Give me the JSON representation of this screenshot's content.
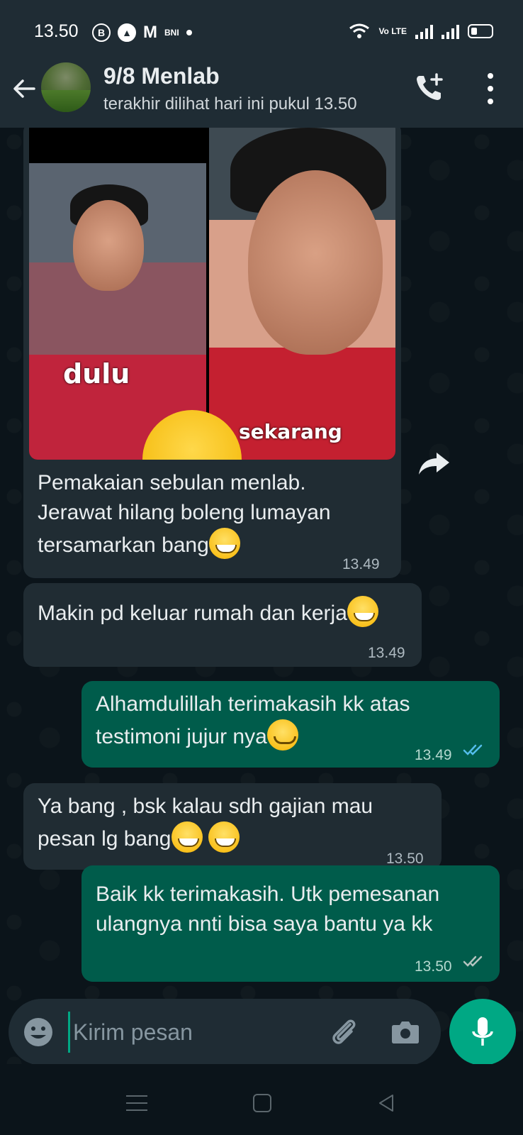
{
  "status_bar": {
    "time": "13.50",
    "notif_b": "B",
    "notif_m": "M",
    "notif_bni": "BNI",
    "volte": "Vo LTE"
  },
  "header": {
    "contact_name": "9/8 Menlab",
    "last_seen": "terakhir dilihat hari ini pukul 13.50"
  },
  "messages": [
    {
      "direction": "in",
      "has_photo": true,
      "photo_labels": [
        "dulu",
        "sekarang"
      ],
      "text_lines": [
        "Pemakaian sebulan menlab.",
        "Jerawat hilang boleng lumayan",
        "tersamarkan bang"
      ],
      "time": "13.49"
    },
    {
      "direction": "in",
      "text_lines": [
        "Makin pd keluar rumah dan kerja"
      ],
      "time": "13.49"
    },
    {
      "direction": "out",
      "text_lines": [
        "Alhamdulillah terimakasih kk atas",
        "testimoni jujur nya"
      ],
      "time": "13.49",
      "ticks": "read"
    },
    {
      "direction": "in",
      "text_lines": [
        "Ya bang , bsk kalau sdh gajian mau",
        "pesan lg bang"
      ],
      "time": "13.50"
    },
    {
      "direction": "out",
      "text_lines": [
        "Baik kk terimakasih. Utk  pemesanan",
        "ulangnya nnti bisa saya bantu ya kk"
      ],
      "time": "13.50",
      "ticks": "delivered"
    }
  ],
  "composer": {
    "placeholder": "Kirim pesan"
  },
  "colors": {
    "header_bg": "#1f2c34",
    "chat_bg": "#0b141a",
    "incoming_bubble": "#202c33",
    "outgoing_bubble": "#005c4b",
    "accent": "#00a884",
    "read_tick": "#53bdeb"
  },
  "icons": [
    "back-arrow-icon",
    "add-call-icon",
    "more-vert-icon",
    "forward-icon",
    "emoji-icon",
    "attach-icon",
    "camera-icon",
    "mic-icon"
  ]
}
